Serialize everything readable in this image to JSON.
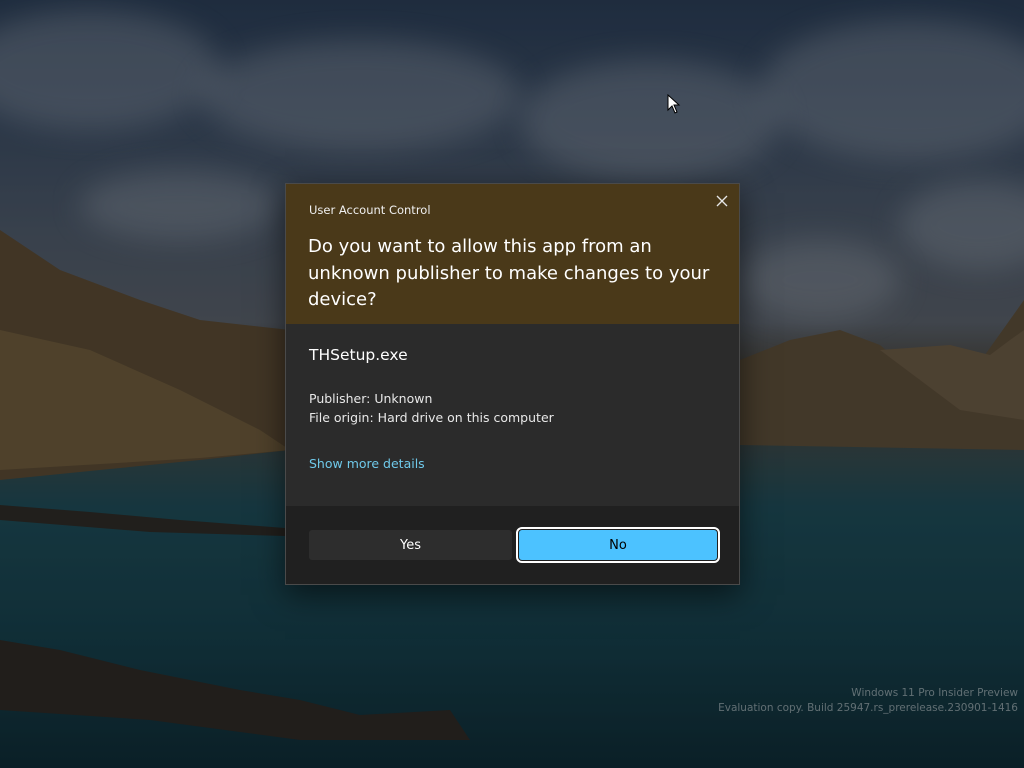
{
  "dialog": {
    "title": "User Account Control",
    "question": "Do you want to allow this app from an unknown publisher to make changes to your device?",
    "app_name": "THSetup.exe",
    "publisher": "Publisher: Unknown",
    "file_origin": "File origin: Hard drive on this computer",
    "details_link": "Show more details",
    "yes_label": "Yes",
    "no_label": "No",
    "close_icon": "close-icon",
    "header_color": "#4a3919",
    "accent_color": "#4cc2ff"
  },
  "desktop": {
    "watermark_line1": "Windows 11 Pro Insider Preview",
    "watermark_line2": "Evaluation copy. Build 25947.rs_prerelease.230901-1416",
    "cursor_icon": "mouse-pointer-icon"
  }
}
